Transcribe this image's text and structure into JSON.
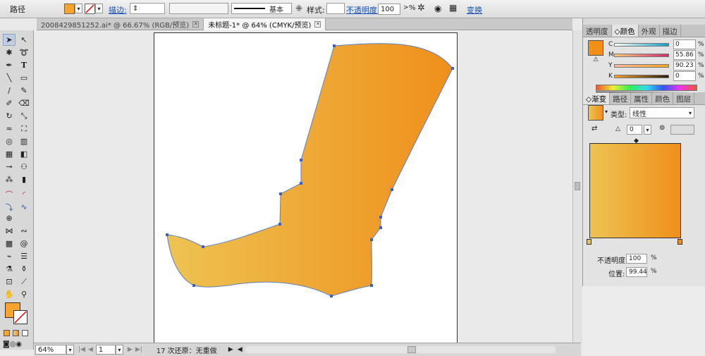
{
  "control_bar": {
    "object_type": "路径",
    "stroke_label": "描边:",
    "stroke_profile": "基本",
    "style_label": "样式:",
    "opacity_label": "不透明度:",
    "opacity_value": "100",
    "opacity_unit": ">",
    "percent": "%",
    "transform_label": "变换",
    "fill_color": "#f5a52f"
  },
  "tabs": [
    {
      "label": "2008429851252.ai* @ 66.67% (RGB/预览)"
    },
    {
      "label": "未标题-1* @ 64% (CMYK/预览)"
    }
  ],
  "color_panel": {
    "tabs": [
      "透明度",
      "◇颜色",
      "外观",
      "描边"
    ],
    "channels": [
      {
        "name": "C",
        "value": "0"
      },
      {
        "name": "M",
        "value": "55.86"
      },
      {
        "name": "Y",
        "value": "90.23"
      },
      {
        "name": "K",
        "value": "0"
      }
    ],
    "percent": "%",
    "swatch_color": "#f28f17"
  },
  "gradient_panel": {
    "tabs": [
      "◇渐变",
      "路径",
      "属性",
      "颜色",
      "图层"
    ],
    "type_label": "类型:",
    "type_value": "线性",
    "angle": "0",
    "start_color": "#eec352",
    "end_color": "#ef8f1b",
    "opacity_label": "不透明度:",
    "opacity_value": "100",
    "location_label": "位置:",
    "location_value": "99.44",
    "percent": "%"
  },
  "status_bar": {
    "zoom": "64%",
    "page": "1",
    "undo_text": "17 次还原：无重做"
  },
  "toolbox": {
    "fill_color": "#f5a52f"
  }
}
